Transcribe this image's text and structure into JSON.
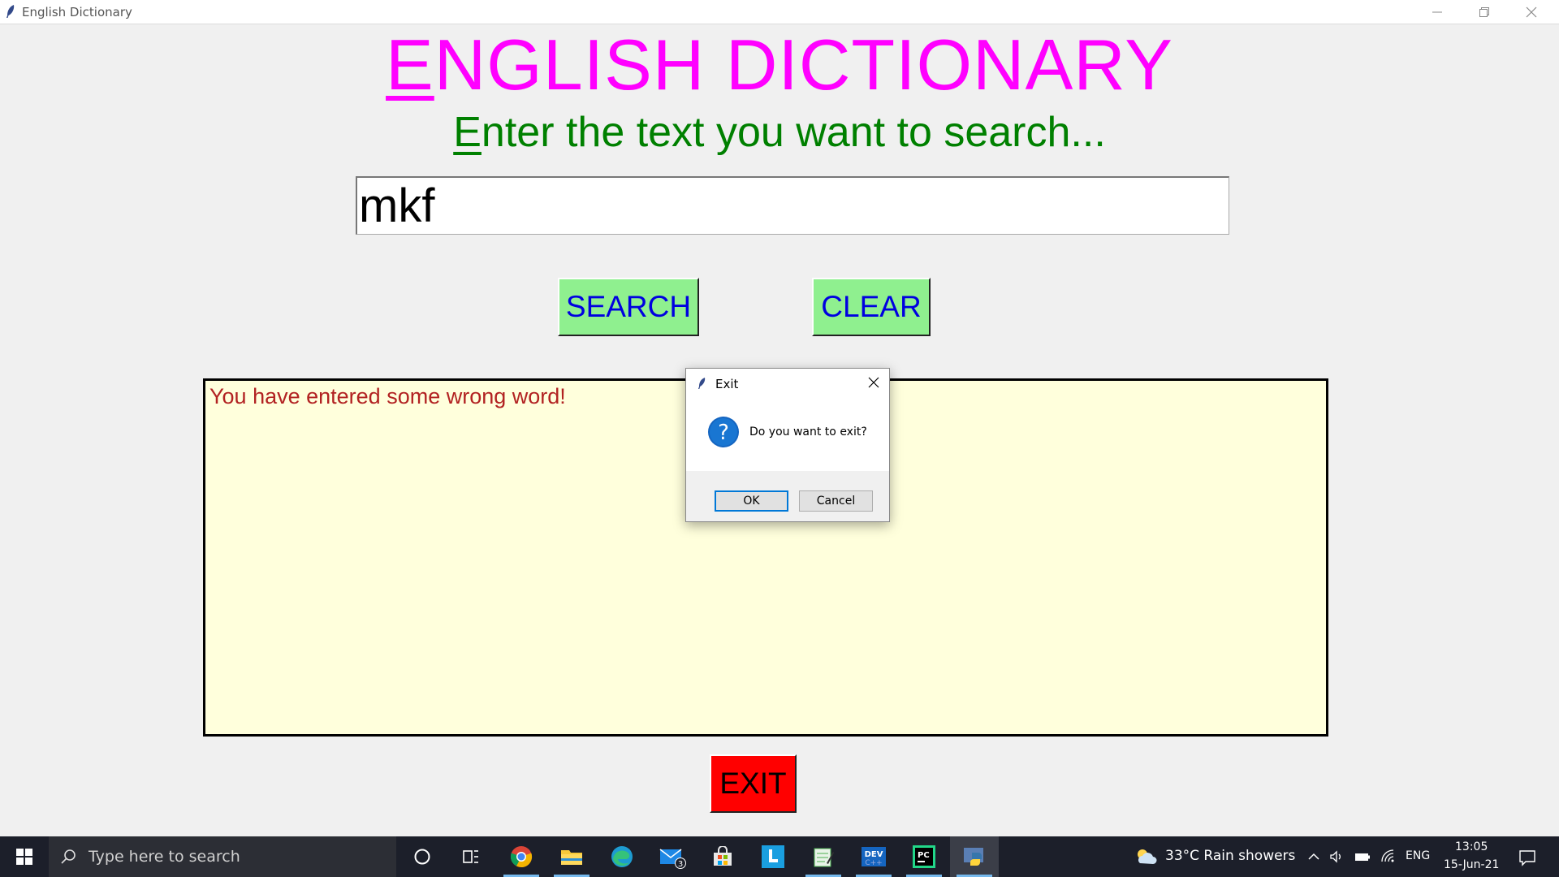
{
  "window": {
    "title": "English Dictionary"
  },
  "app": {
    "heading_first": "E",
    "heading_rest": "NGLISH DICTIONARY",
    "subheading_first": "E",
    "subheading_rest": "nter the text you want to search...",
    "search_value": "mkf",
    "search_button": "SEARCH",
    "clear_button": "CLEAR",
    "result_text": "You have entered some wrong word!",
    "exit_button": "EXIT",
    "colors": {
      "heading": "#ff00ff",
      "subheading": "#008000",
      "button_bg": "#8ff08f",
      "button_text": "#0000e0",
      "result_bg": "#ffffdc",
      "result_text": "#b22222",
      "exit_bg": "#ff0000"
    }
  },
  "dialog": {
    "title": "Exit",
    "message": "Do you want to exit?",
    "ok_label": "OK",
    "cancel_label": "Cancel",
    "icon": "question-icon"
  },
  "taskbar": {
    "search_placeholder": "Type here to search",
    "apps": [
      "cortana-icon",
      "task-view-icon",
      "chrome-icon",
      "file-explorer-icon",
      "edge-icon",
      "mail-icon",
      "store-icon",
      "l-app-icon",
      "notepad-icon",
      "devcpp-icon",
      "pycharm-icon",
      "python-icon"
    ],
    "mail_badge": "3",
    "weather": "33°C  Rain showers",
    "language": "ENG",
    "time": "13:05",
    "date": "15-Jun-21"
  }
}
